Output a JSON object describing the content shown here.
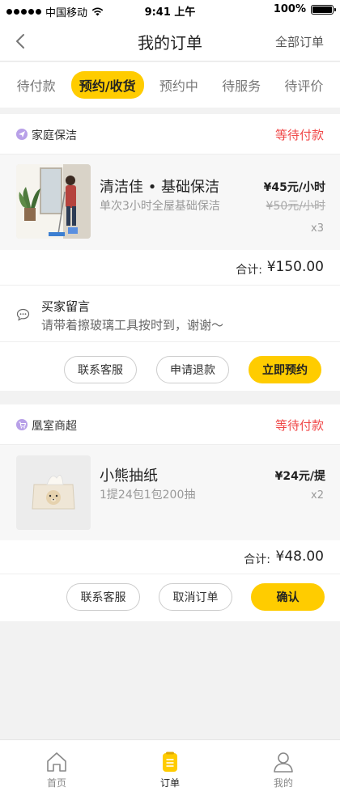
{
  "status_bar": {
    "carrier": "中国移动",
    "time": "9:41 上午",
    "battery": "100%"
  },
  "header": {
    "title": "我的订单",
    "all_orders_label": "全部订单"
  },
  "tabs": [
    {
      "label": "待付款"
    },
    {
      "label": "预约/收货"
    },
    {
      "label": "预约中"
    },
    {
      "label": "待服务"
    },
    {
      "label": "待评价"
    }
  ],
  "orders": [
    {
      "shop": "家庭保洁",
      "status": "等待付款",
      "item": {
        "name": "清洁佳 • 基础保洁",
        "desc": "单次3小时全屋基础保洁",
        "price": "¥45元/小时",
        "original_price": "¥50元/小时",
        "qty": "x3"
      },
      "total_label": "合计:",
      "total": "¥150.00",
      "note_title": "买家留言",
      "note": "请带着擦玻璃工具按时到，谢谢～",
      "buttons": [
        "联系客服",
        "申请退款",
        "立即预约"
      ]
    },
    {
      "shop": "凰室商超",
      "status": "等待付款",
      "item": {
        "name": "小熊抽纸",
        "desc": "1提24包1包200抽",
        "price": "¥24元/提",
        "qty": "x2"
      },
      "total_label": "合计:",
      "total": "¥48.00",
      "buttons": [
        "联系客服",
        "取消订单",
        "确认"
      ]
    }
  ],
  "tabbar": [
    {
      "label": "首页",
      "icon": "home-icon"
    },
    {
      "label": "订单",
      "icon": "order-icon"
    },
    {
      "label": "我的",
      "icon": "profile-icon"
    }
  ],
  "colors": {
    "accent": "#ffcc00",
    "status_red": "#f04848"
  }
}
